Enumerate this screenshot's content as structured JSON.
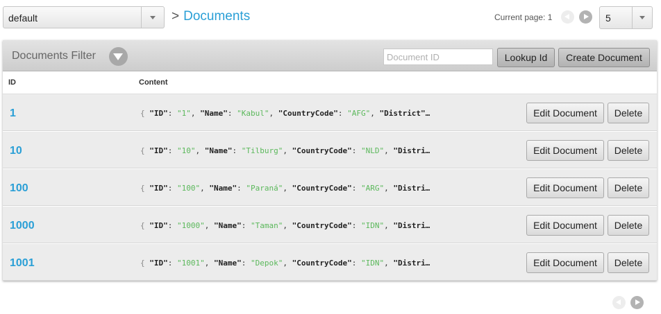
{
  "header": {
    "bucket": "default",
    "breadcrumb_separator": ">",
    "breadcrumb_current": "Documents",
    "current_page_label": "Current page: 1",
    "page_size": "5"
  },
  "panel": {
    "title": "Documents Filter",
    "doc_id_placeholder": "Document ID",
    "lookup_label": "Lookup Id",
    "create_label": "Create Document",
    "col_id": "ID",
    "col_content": "Content"
  },
  "rows": [
    {
      "id": "1",
      "content": {
        "open": "{ ",
        "id_key": "\"ID\"",
        "id_val": "\"1\"",
        "name_key": "\"Name\"",
        "name_val": "\"Kabul\"",
        "cc_key": "\"CountryCode\"",
        "cc_val": "\"AFG\"",
        "tail": "\"District\"…"
      },
      "edit_label": "Edit Document",
      "delete_label": "Delete"
    },
    {
      "id": "10",
      "content": {
        "open": "{ ",
        "id_key": "\"ID\"",
        "id_val": "\"10\"",
        "name_key": "\"Name\"",
        "name_val": "\"Tilburg\"",
        "cc_key": "\"CountryCode\"",
        "cc_val": "\"NLD\"",
        "tail": "\"Distri…"
      },
      "edit_label": "Edit Document",
      "delete_label": "Delete"
    },
    {
      "id": "100",
      "content": {
        "open": "{ ",
        "id_key": "\"ID\"",
        "id_val": "\"100\"",
        "name_key": "\"Name\"",
        "name_val": "\"Paraná\"",
        "cc_key": "\"CountryCode\"",
        "cc_val": "\"ARG\"",
        "tail": "\"Distri…"
      },
      "edit_label": "Edit Document",
      "delete_label": "Delete"
    },
    {
      "id": "1000",
      "content": {
        "open": "{ ",
        "id_key": "\"ID\"",
        "id_val": "\"1000\"",
        "name_key": "\"Name\"",
        "name_val": "\"Taman\"",
        "cc_key": "\"CountryCode\"",
        "cc_val": "\"IDN\"",
        "tail": "\"Distri…"
      },
      "edit_label": "Edit Document",
      "delete_label": "Delete"
    },
    {
      "id": "1001",
      "content": {
        "open": "{ ",
        "id_key": "\"ID\"",
        "id_val": "\"1001\"",
        "name_key": "\"Name\"",
        "name_val": "\"Depok\"",
        "cc_key": "\"CountryCode\"",
        "cc_val": "\"IDN\"",
        "tail": "\"Distri…"
      },
      "edit_label": "Edit Document",
      "delete_label": "Delete"
    }
  ],
  "colors": {
    "accent": "#2a9fd6",
    "string_value": "#5bb85b"
  }
}
